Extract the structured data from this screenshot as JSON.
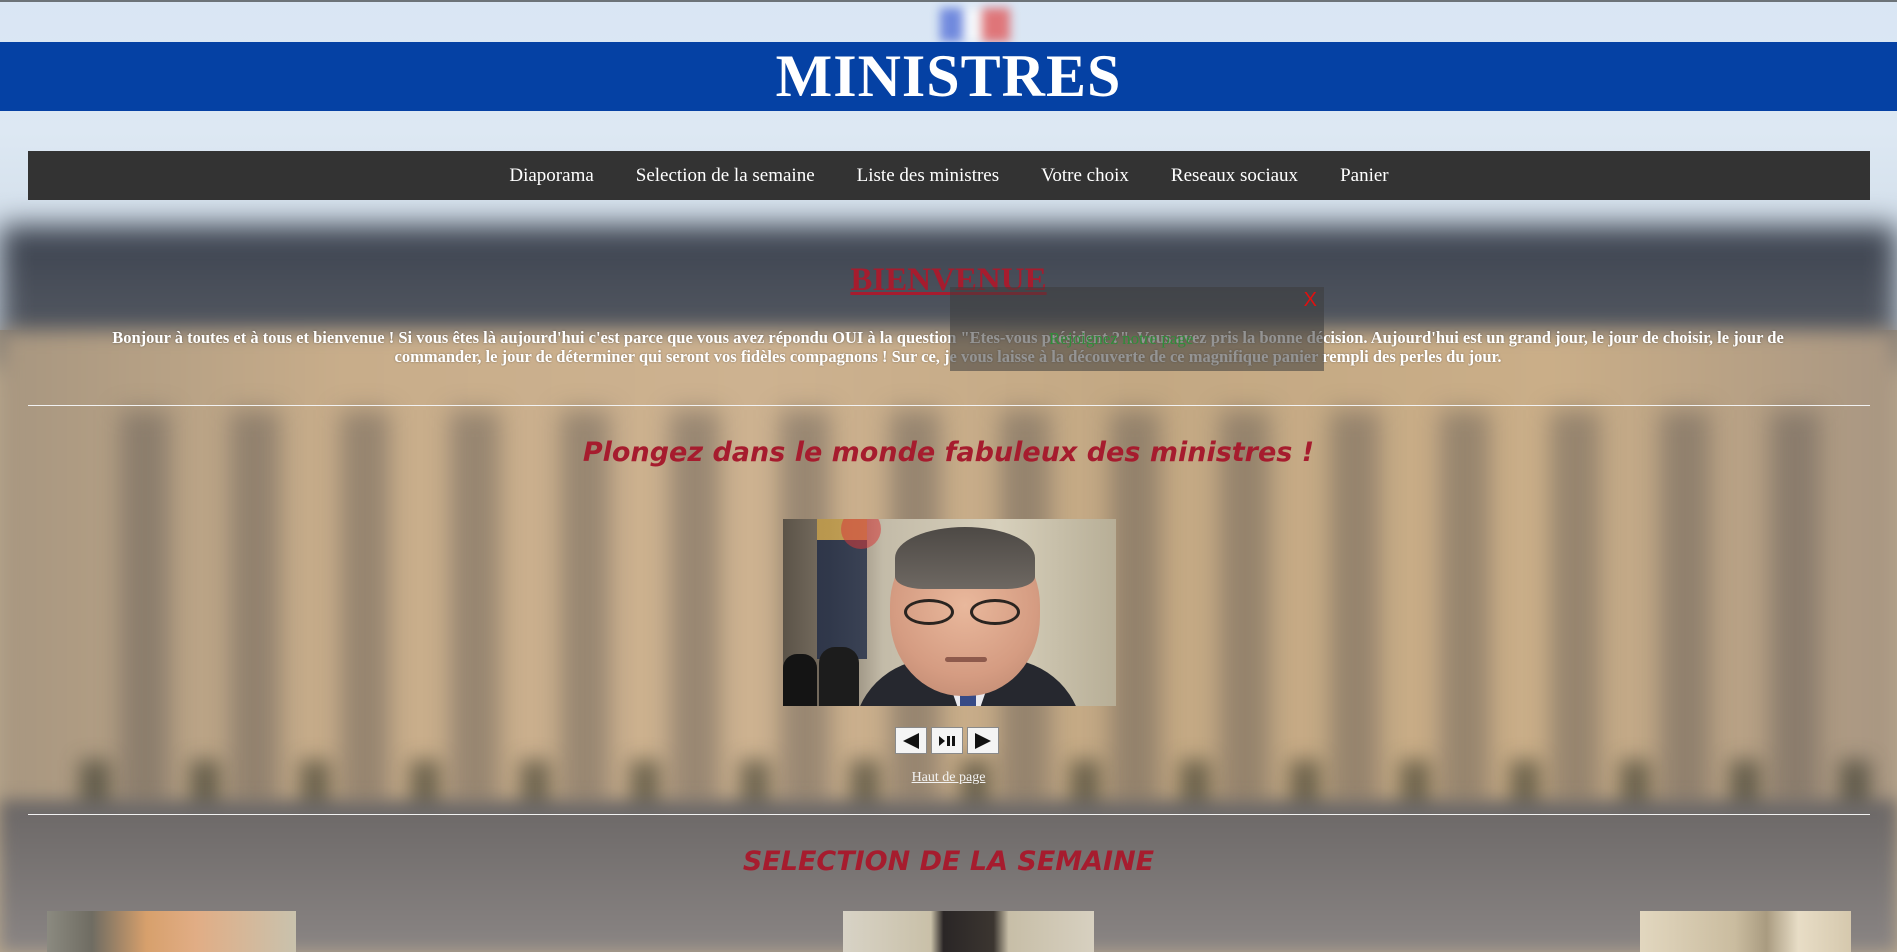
{
  "header": {
    "title": "MINISTRES"
  },
  "nav": {
    "items": [
      {
        "label": "Diaporama"
      },
      {
        "label": "Selection de la semaine"
      },
      {
        "label": "Liste des ministres"
      },
      {
        "label": "Votre choix"
      },
      {
        "label": "Reseaux sociaux"
      },
      {
        "label": "Panier"
      }
    ]
  },
  "welcome": {
    "title": "BIENVENUE",
    "line1": "Bonjour à toutes et à tous et bienvenue ! Si vous êtes là aujourd'hui c'est parce que vous avez répondu OUI à la question \"Etes-vous président ?\". Vous avez pris la bonne décision. Aujourd'hui est un grand jour, le jour de choisir, le jour de",
    "line2": "commander, le jour de déterminer qui seront vos fidèles compagnons ! Sur ce, je vous laisse à la découverte de ce magnifique panier rempli des perles du jour."
  },
  "popup": {
    "close_label": "X",
    "text": "Rejoignez notre page"
  },
  "diaporama": {
    "heading": "Plongez dans le monde fabuleux des ministres !",
    "controls": {
      "prev_icon": "arrow-left-icon",
      "play_pause_icon": "play-pause-icon",
      "next_icon": "arrow-right-icon"
    },
    "top_link": "Haut de page"
  },
  "selection": {
    "heading": "SELECTION DE LA SEMAINE"
  },
  "colors": {
    "header_blue": "#0541a4",
    "nav_bg": "#333333",
    "accent_red": "#a61c2e",
    "popup_green": "#2f8d3a"
  }
}
